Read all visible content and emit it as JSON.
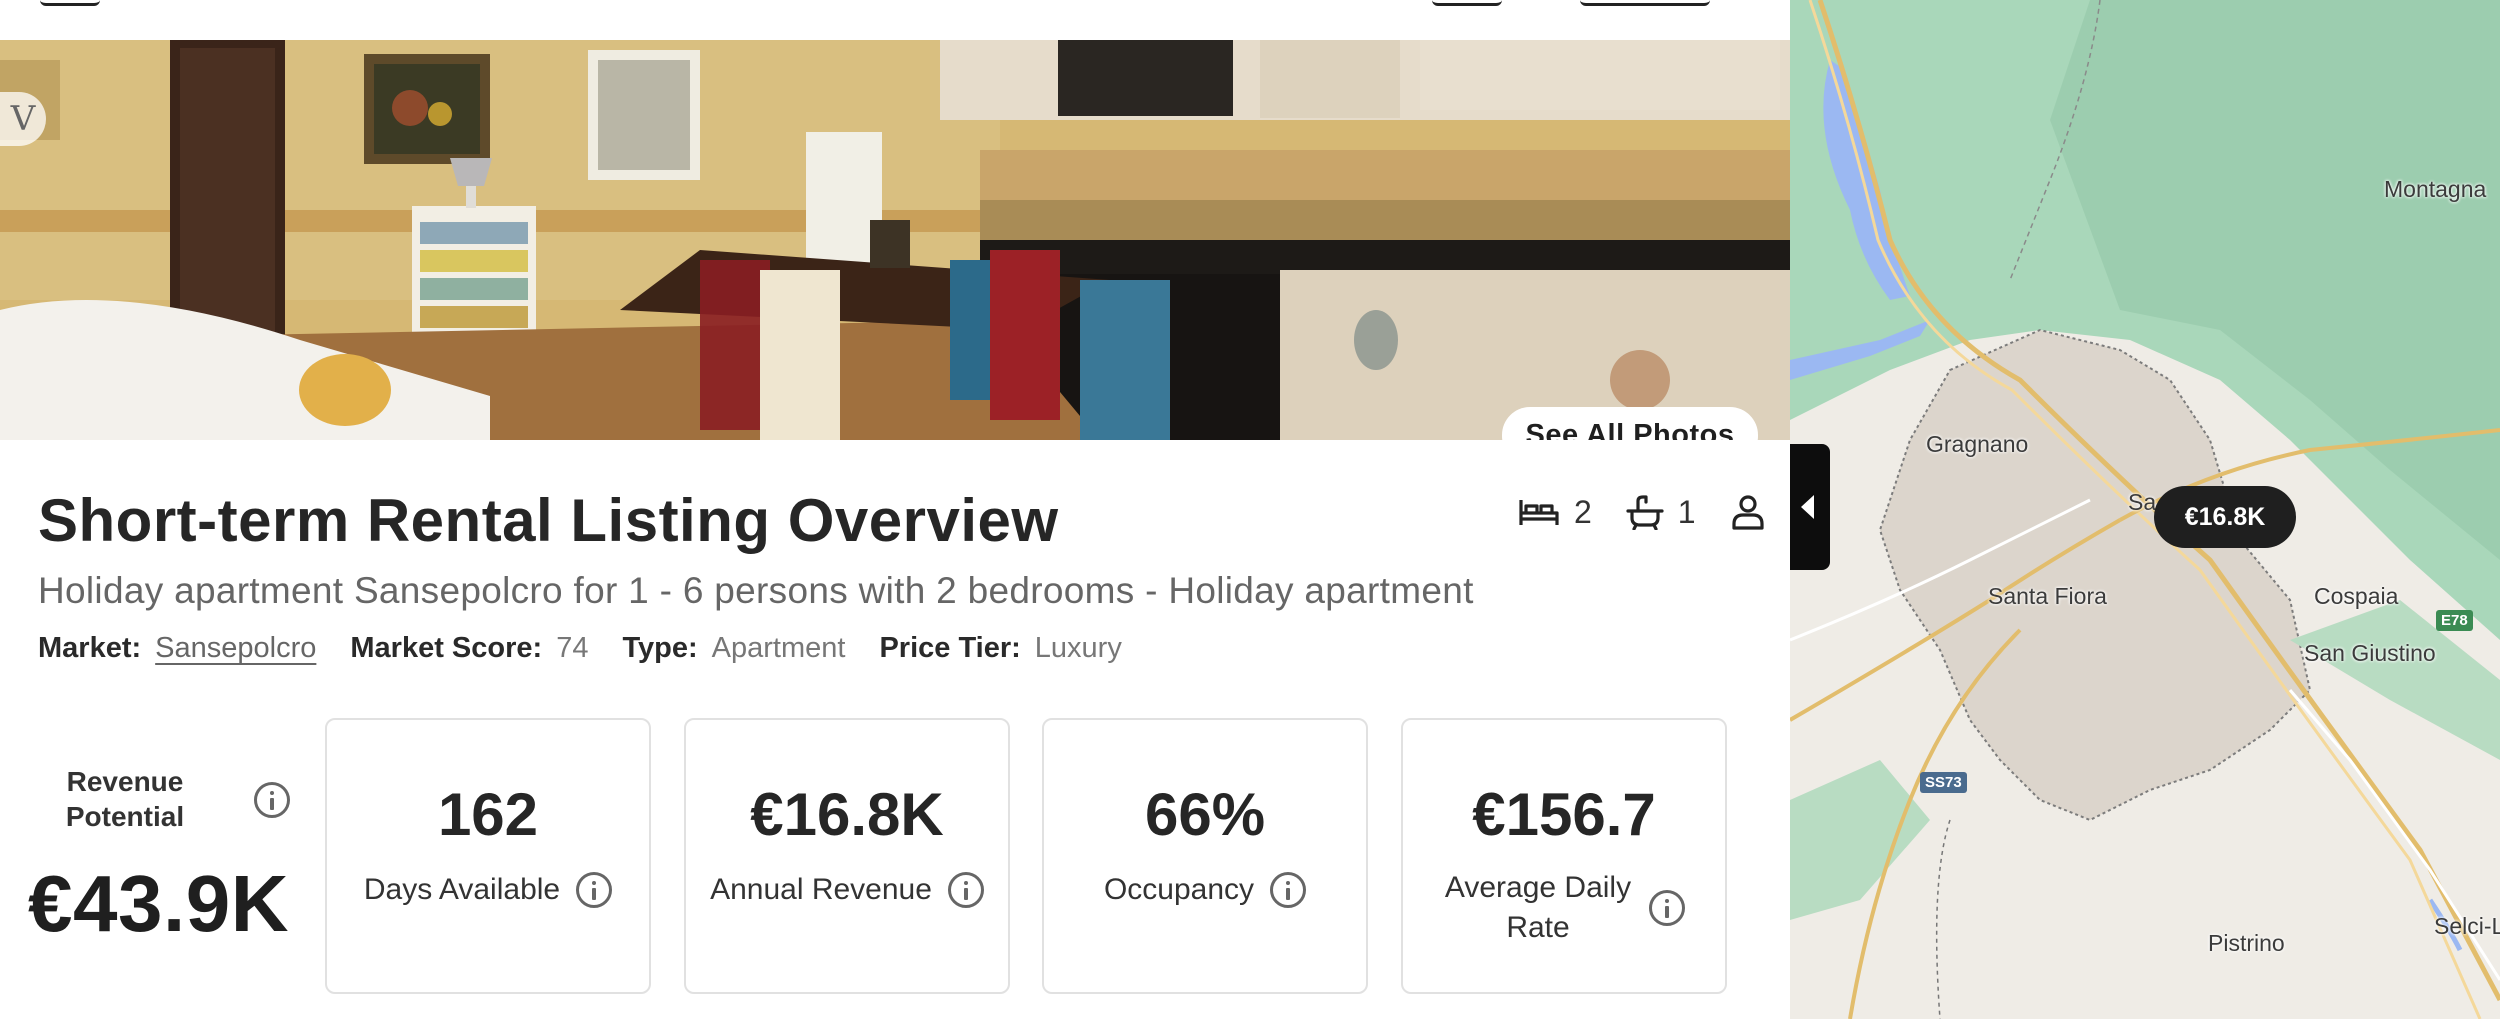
{
  "hero": {
    "see_all_label": "See All Photos",
    "brand_badge": "V"
  },
  "listing": {
    "title": "Short-term Rental Listing Overview",
    "subtitle": "Holiday apartment Sansepolcro for 1 - 6 persons with 2 bedrooms - Holiday apartment",
    "specs": {
      "bedrooms": "2",
      "bathrooms": "1"
    },
    "meta": {
      "market_label": "Market:",
      "market_value": "Sansepolcro",
      "score_label": "Market Score:",
      "score_value": "74",
      "type_label": "Type:",
      "type_value": "Apartment",
      "tier_label": "Price Tier:",
      "tier_value": "Luxury"
    }
  },
  "revenue_potential": {
    "label": "Revenue Potential",
    "value": "€43.9K"
  },
  "stats": [
    {
      "value": "162",
      "label": "Days Available"
    },
    {
      "value": "€16.8K",
      "label": "Annual Revenue"
    },
    {
      "value": "66%",
      "label": "Occupancy"
    },
    {
      "value": "€156.7",
      "label": "Average Daily Rate"
    }
  ],
  "map": {
    "pin_price": "€16.8K",
    "places": [
      "Montagna",
      "Gragnano",
      "Sa",
      "Santa Fiora",
      "Cospaia",
      "San Giustino",
      "Pistrino",
      "Selci-L"
    ],
    "road_labels": [
      "SS73",
      "E78"
    ]
  },
  "colors": {
    "accent": "#1f1f1f",
    "map_forest": "#a8d5b8",
    "map_water": "#9bb8f2",
    "map_road": "#e2bd6c"
  }
}
